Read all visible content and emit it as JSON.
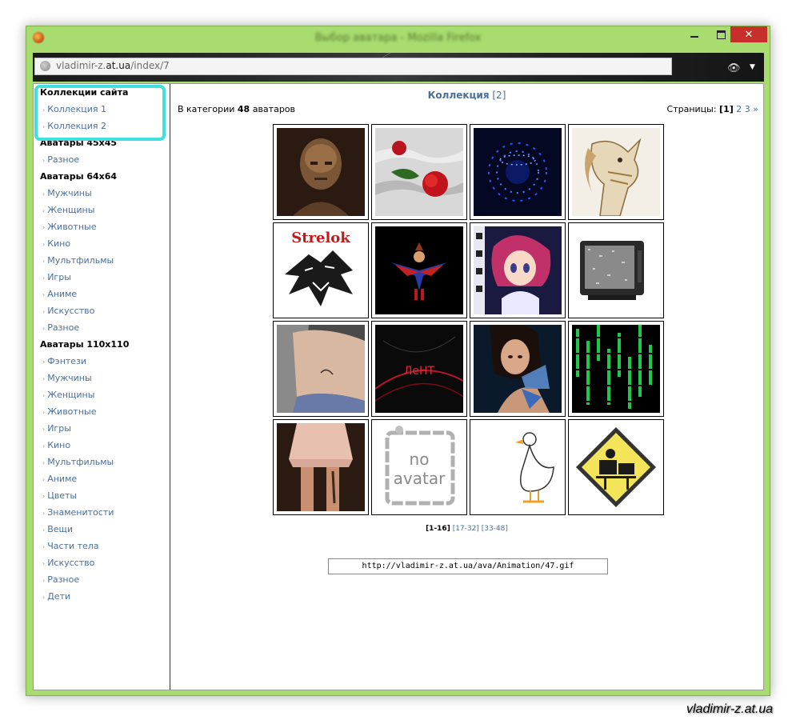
{
  "window": {
    "title": "Выбор аватара - Mozilla Firefox",
    "controls": {
      "minimize": "",
      "maximize": "",
      "close": "✕"
    }
  },
  "browser": {
    "url_prefix": "vladimir-z.",
    "url_domain": "at.ua",
    "url_path": "/index/7"
  },
  "sidebar": {
    "sections": [
      {
        "title": "Коллекции сайта",
        "items": [
          "Коллекция 1",
          "Коллекция 2"
        ]
      },
      {
        "title": "Аватары 45x45",
        "items": [
          "Разное"
        ]
      },
      {
        "title": "Аватары 64x64",
        "items": [
          "Мужчины",
          "Женщины",
          "Животные",
          "Кино",
          "Мультфильмы",
          "Игры",
          "Аниме",
          "Искусство",
          "Разное"
        ]
      },
      {
        "title": "Аватары 110x110",
        "items": [
          "Фэнтези",
          "Мужчины",
          "Женщины",
          "Животные",
          "Игры",
          "Кино",
          "Мультфильмы",
          "Аниме",
          "Цветы",
          "Знаменитости",
          "Вещи",
          "Части тела",
          "Искусство",
          "Разное",
          "Дети"
        ]
      }
    ]
  },
  "main": {
    "collection_name": "Коллекция",
    "collection_count": "[2]",
    "category_prefix": "В категории ",
    "category_count": "48",
    "category_suffix": " аватаров",
    "pages_label": "Страницы: ",
    "pages_current": "[1]",
    "pages_links": [
      "2",
      "3"
    ],
    "pages_next": "»",
    "pager_current": "[1-16]",
    "pager_links": [
      "[17-32]",
      "[33-48]"
    ],
    "selected_url": "http://vladimir-z.at.ua/ava/Animation/47.gif"
  },
  "avatars": [
    "bald-man-avatar",
    "red-rose-avatar",
    "blue-sphere-avatar",
    "unicorn-avatar",
    "strelok-wolf-avatar",
    "fairy-avatar",
    "anime-girl-avatar",
    "tv-static-avatar",
    "midriff-avatar",
    "neht-avatar",
    "woman-butterfly-avatar",
    "matrix-code-avatar",
    "legs-skirt-avatar",
    "no-avatar",
    "duck-avatar",
    "sign-avatar"
  ],
  "no_avatar_text": [
    "no",
    "avatar"
  ],
  "strelok_text": "Strelok",
  "neht_text": "ЛеНТ",
  "watermark": "vladimir-z.at.ua"
}
